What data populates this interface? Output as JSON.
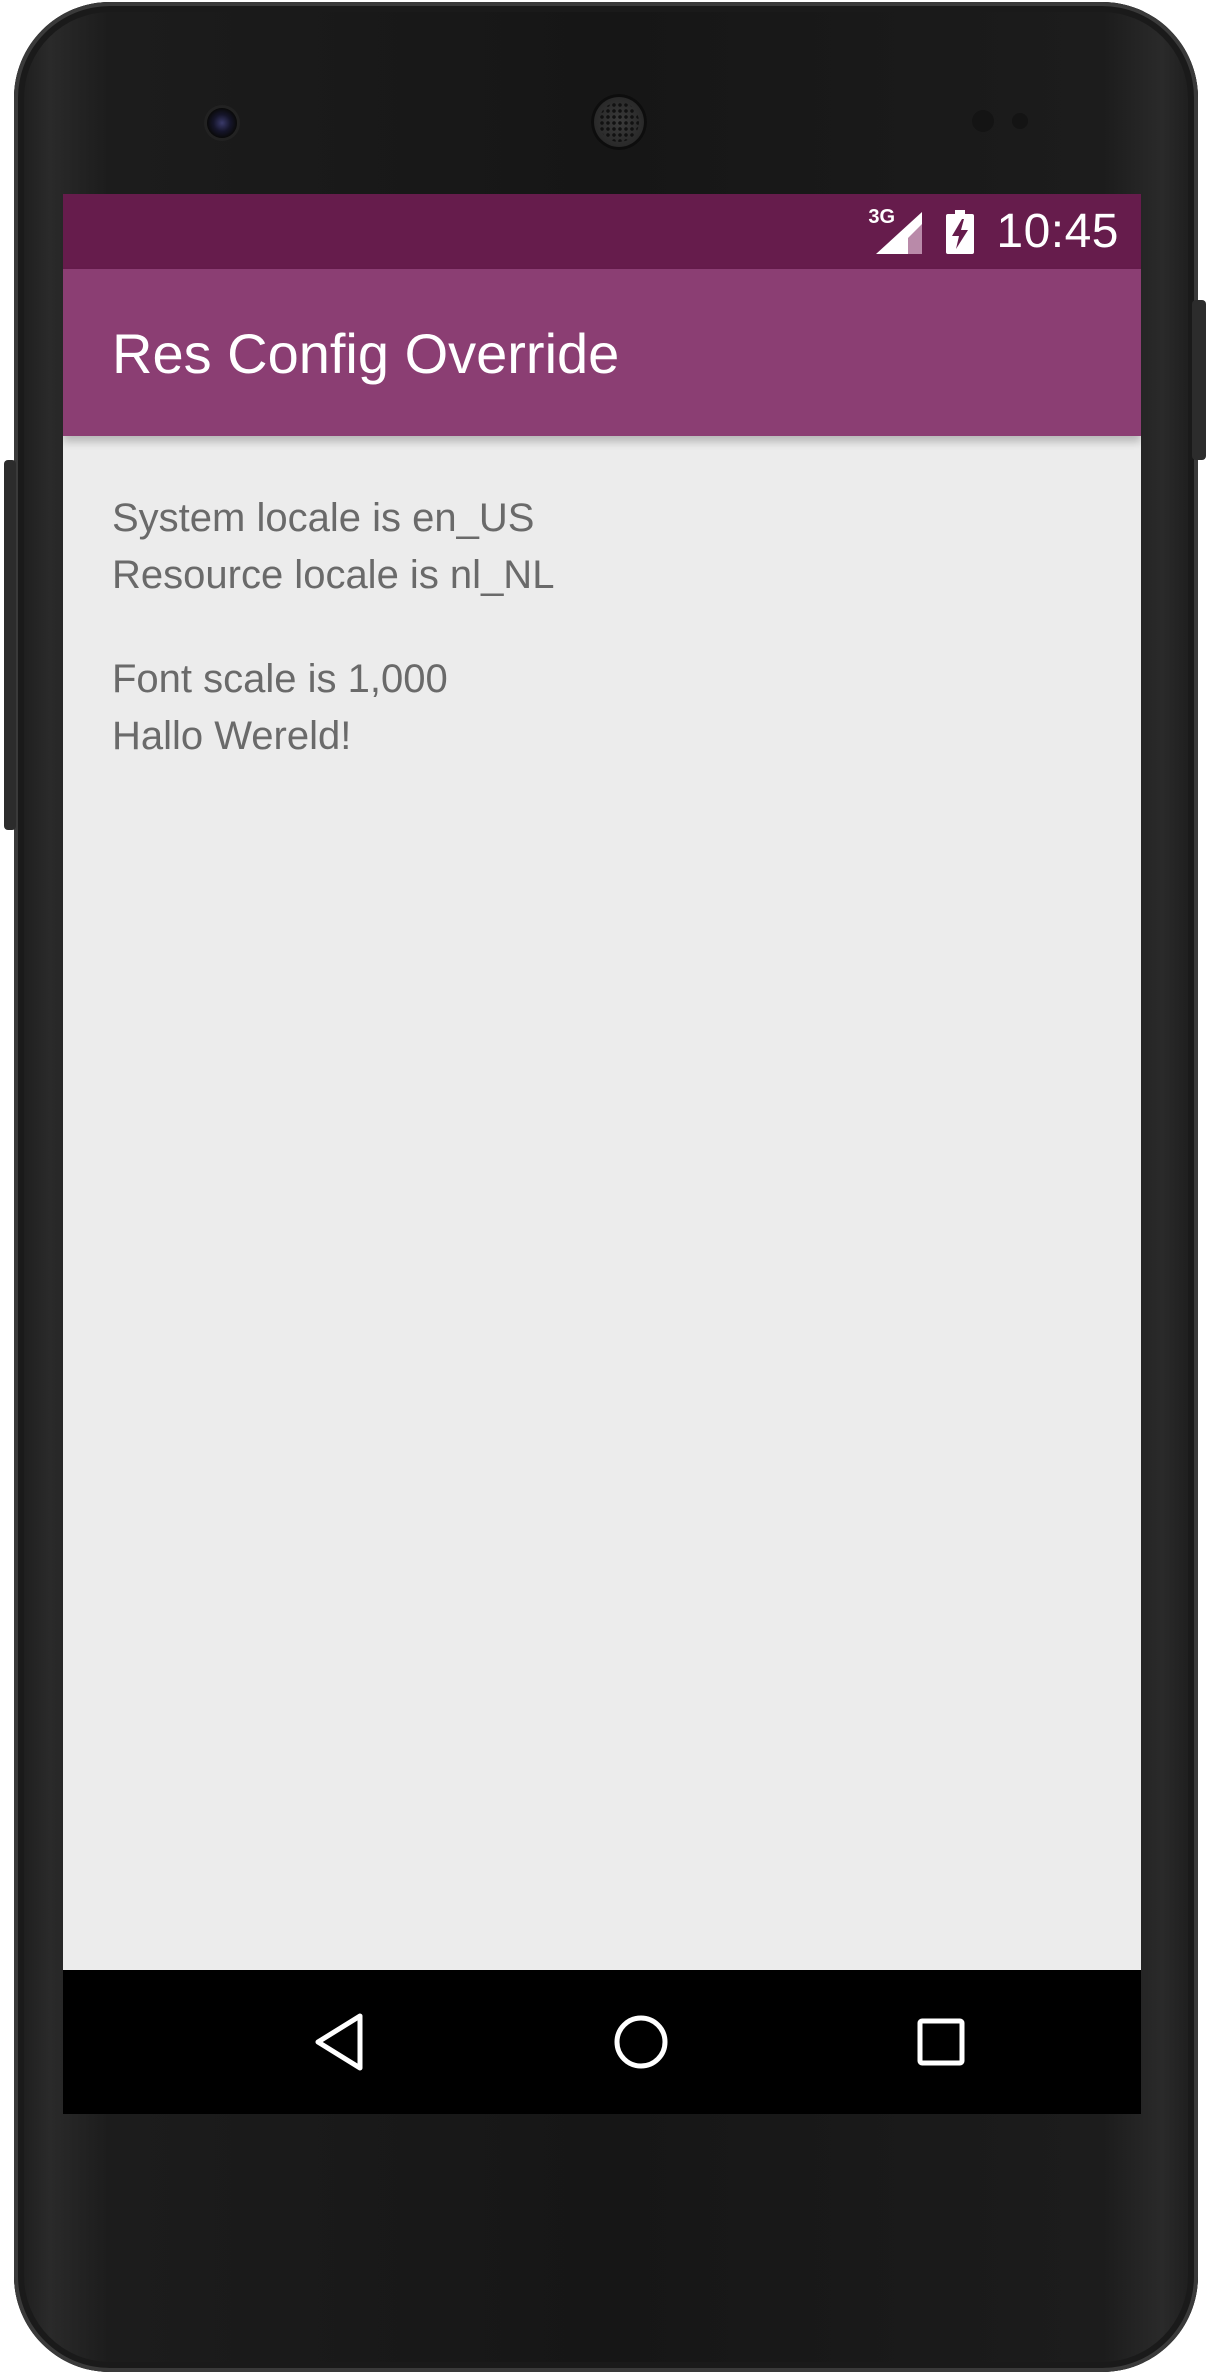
{
  "status_bar": {
    "network_type": "3G",
    "time": "10:45",
    "icons": [
      "signal-3g-icon",
      "battery-charging-icon"
    ]
  },
  "app_bar": {
    "title": "Res Config Override"
  },
  "content": {
    "lines_group1": [
      "System locale is en_US",
      "Resource locale is nl_NL"
    ],
    "lines_group2": [
      "Font scale is 1,000",
      "Hallo Wereld!"
    ]
  },
  "nav_bar": {
    "buttons": [
      "back-icon",
      "home-icon",
      "recents-icon"
    ]
  },
  "colors": {
    "status_bar": "#661c4c",
    "app_bar": "#8b3e73",
    "content_bg": "#ececec",
    "content_text": "#6a6a6a"
  }
}
